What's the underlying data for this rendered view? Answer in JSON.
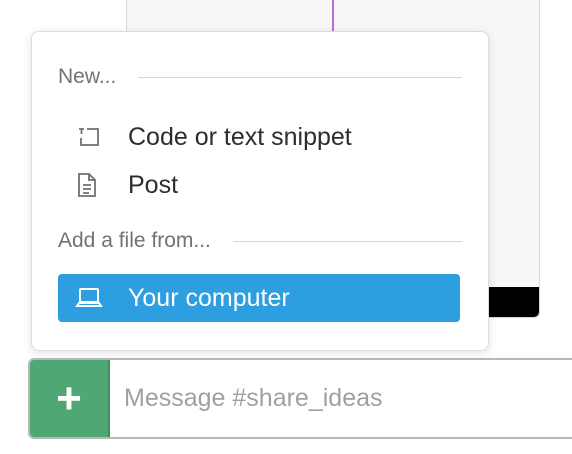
{
  "menu": {
    "new_header": "New...",
    "items_new": [
      {
        "label": "Code or text snippet",
        "icon": "snippet-icon"
      },
      {
        "label": "Post",
        "icon": "document-icon"
      }
    ],
    "add_header": "Add a file from...",
    "items_add": [
      {
        "label": "Your computer",
        "icon": "laptop-icon",
        "highlighted": true
      }
    ],
    "highlight_color": "#2d9ee0"
  },
  "composer": {
    "plus_label": "+",
    "placeholder": "Message #share_ideas",
    "value": "",
    "button_color": "#4fa874"
  }
}
